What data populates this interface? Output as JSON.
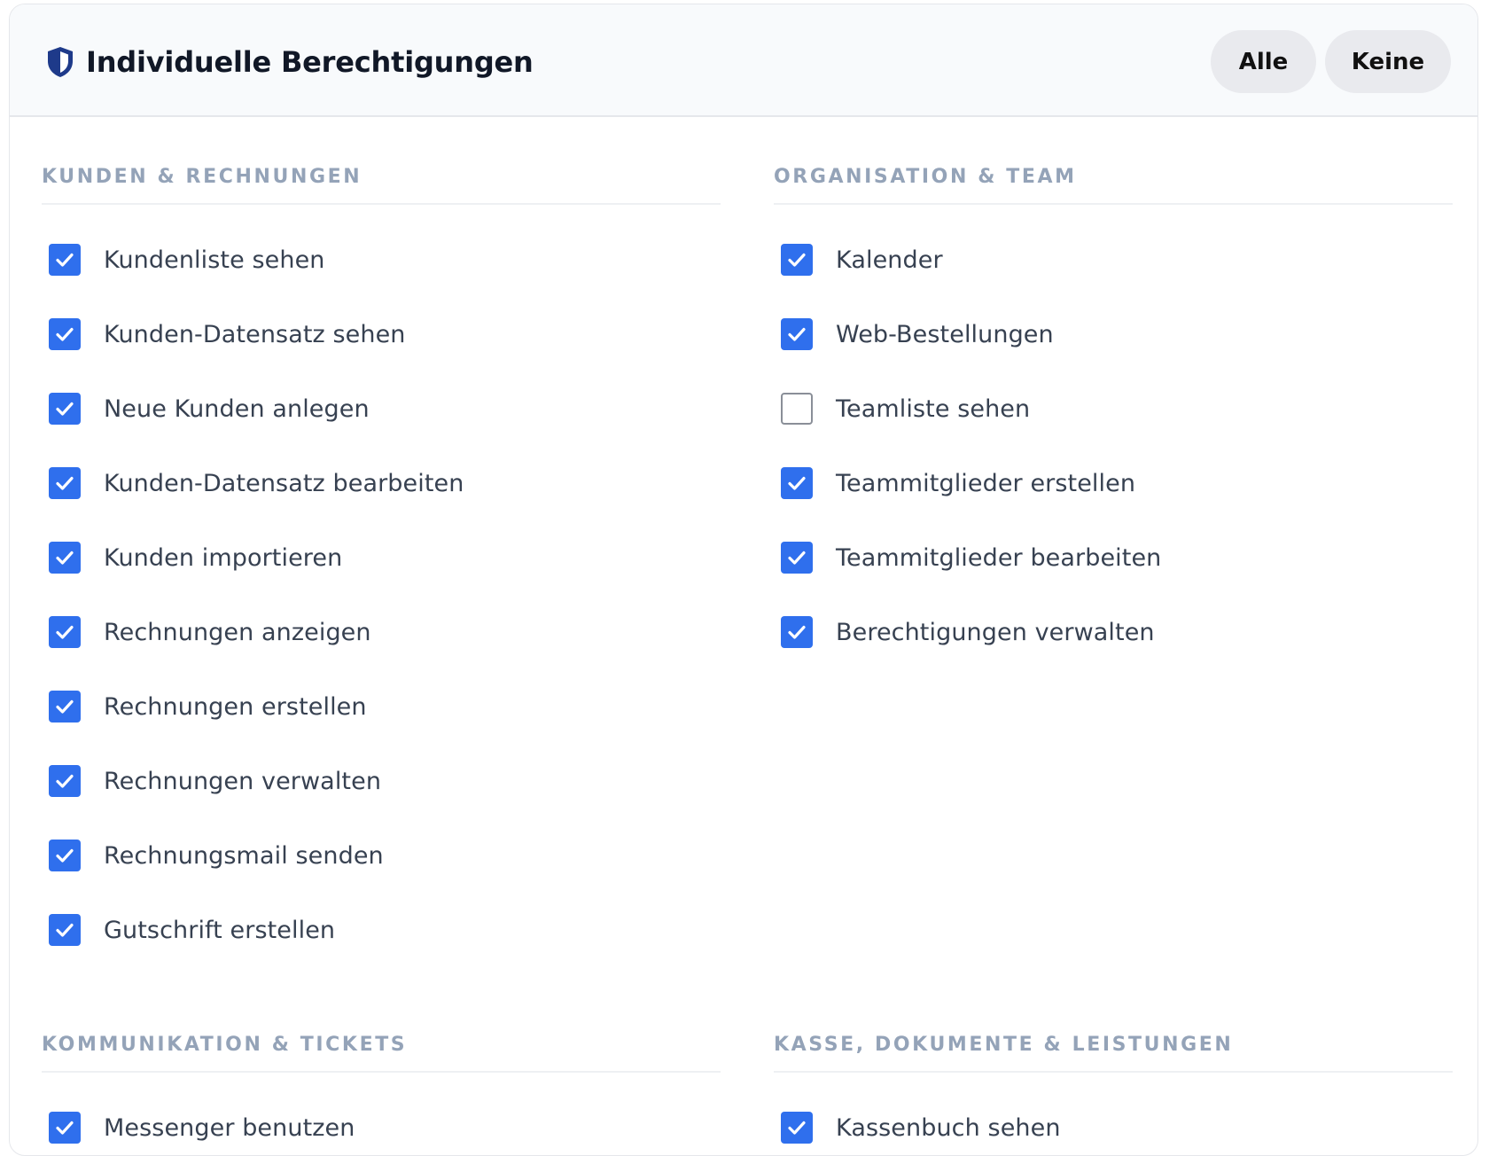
{
  "header": {
    "title": "Individuelle Berechtigungen",
    "select_all_label": "Alle",
    "select_none_label": "Keine"
  },
  "colors": {
    "checkbox_checked": "#2f6fed",
    "section_title": "#94a3b8",
    "shield_icon": "#1e3a8a"
  },
  "sections": [
    {
      "title": "KUNDEN & RECHNUNGEN",
      "items": [
        {
          "label": "Kundenliste sehen",
          "checked": true
        },
        {
          "label": "Kunden-Datensatz sehen",
          "checked": true
        },
        {
          "label": "Neue Kunden anlegen",
          "checked": true
        },
        {
          "label": "Kunden-Datensatz bearbeiten",
          "checked": true
        },
        {
          "label": "Kunden importieren",
          "checked": true
        },
        {
          "label": "Rechnungen anzeigen",
          "checked": true
        },
        {
          "label": "Rechnungen erstellen",
          "checked": true
        },
        {
          "label": "Rechnungen verwalten",
          "checked": true
        },
        {
          "label": "Rechnungsmail senden",
          "checked": true
        },
        {
          "label": "Gutschrift erstellen",
          "checked": true
        }
      ]
    },
    {
      "title": "ORGANISATION & TEAM",
      "items": [
        {
          "label": "Kalender",
          "checked": true
        },
        {
          "label": "Web-Bestellungen",
          "checked": true
        },
        {
          "label": "Teamliste sehen",
          "checked": false
        },
        {
          "label": "Teammitglieder erstellen",
          "checked": true
        },
        {
          "label": "Teammitglieder bearbeiten",
          "checked": true
        },
        {
          "label": "Berechtigungen verwalten",
          "checked": true
        }
      ]
    },
    {
      "title": "KOMMUNIKATION & TICKETS",
      "items": [
        {
          "label": "Messenger benutzen",
          "checked": true
        }
      ]
    },
    {
      "title": "KASSE, DOKUMENTE & LEISTUNGEN",
      "items": [
        {
          "label": "Kassenbuch sehen",
          "checked": true
        }
      ]
    }
  ]
}
